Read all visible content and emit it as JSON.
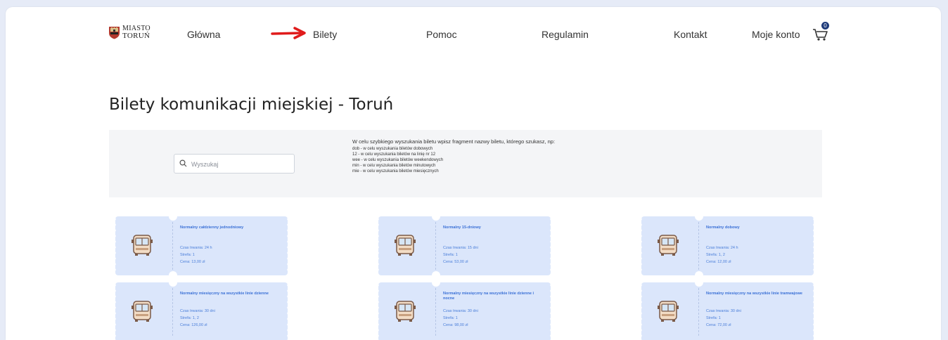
{
  "header": {
    "logo_line1": "MIASTO",
    "logo_line2": "TORUŃ",
    "nav": [
      "Główna",
      "Bilety",
      "Pomoc",
      "Regulamin",
      "Kontakt",
      "Moje konto"
    ],
    "cart_count": "0"
  },
  "page": {
    "title": "Bilety komunikacji miejskiej - Toruń"
  },
  "search": {
    "placeholder": "Wyszukaj",
    "hint_lead": "W celu szybkiego wyszukania biletu wpisz fragment nazwy biletu, którego szukasz, np:",
    "hint_lines": [
      "dob - w celu wyszukania biletów dobowych",
      "12 - w celu wyszukania biletów na linię nr 12",
      "wee - w celu wyszukania biletów weekendowych",
      "min - w celu wyszukania biletów minutowych",
      "mie - w celu wyszukania biletów miesięcznych"
    ]
  },
  "tickets": [
    {
      "title": "Normalny całdzienny jednodniowy",
      "l1": "Czas trwania: 24 h",
      "l2": "Strefa: 1",
      "l3": "Cena: 13,00 zł"
    },
    {
      "title": "Normalny 15-dniowy",
      "l1": "Czas trwania: 15 dni",
      "l2": "Strefa: 1",
      "l3": "Cena: 53,00 zł"
    },
    {
      "title": "Normalny dobowy",
      "l1": "Czas trwania: 24 h",
      "l2": "Strefa: 1, 2",
      "l3": "Cena: 12,00 zł"
    },
    {
      "title": "Normalny miesięczny na wszystkie linie dzienne",
      "l1": "Czas trwania: 30 dni",
      "l2": "Strefa: 1, 2",
      "l3": "Cena: 126,00 zł"
    },
    {
      "title": "Normalny miesięczny na wszystkie linie dzienne i nocne",
      "l1": "Czas trwania: 30 dni",
      "l2": "Strefa: 1",
      "l3": "Cena: 98,00 zł"
    },
    {
      "title": "Normalny miesięczny na wszystkie linie tramwajowe",
      "l1": "Czas trwania: 30 dni",
      "l2": "Strefa: 1",
      "l3": "Cena: 72,00 zł"
    }
  ],
  "colors": {
    "accent": "#3a70d6",
    "ticket_bg": "#dbe6fb",
    "arrow": "#e01b1b",
    "badge": "#1f3b7a"
  }
}
